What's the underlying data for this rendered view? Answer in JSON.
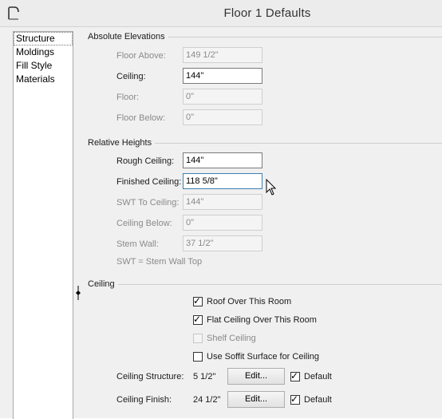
{
  "window": {
    "title": "Floor 1 Defaults"
  },
  "nav": {
    "items": [
      "Structure",
      "Moldings",
      "Fill Style",
      "Materials"
    ]
  },
  "absolute_elevations": {
    "title": "Absolute Elevations",
    "floor_above": {
      "label": "Floor Above:",
      "value": "149 1/2\""
    },
    "ceiling": {
      "label": "Ceiling:",
      "value": "144\""
    },
    "floor": {
      "label": "Floor:",
      "value": "0\""
    },
    "floor_below": {
      "label": "Floor Below:",
      "value": "0\""
    }
  },
  "relative_heights": {
    "title": "Relative Heights",
    "rough_ceiling": {
      "label": "Rough Ceiling:",
      "value": "144\""
    },
    "finished_ceiling": {
      "label": "Finished Ceiling:",
      "value": "118 5/8\""
    },
    "swt_to_ceiling": {
      "label": "SWT To Ceiling:",
      "value": "144\""
    },
    "ceiling_below": {
      "label": "Ceiling Below:",
      "value": "0\""
    },
    "stem_wall": {
      "label": "Stem Wall:",
      "value": "37 1/2\""
    },
    "note": "SWT = Stem Wall Top"
  },
  "ceiling": {
    "title": "Ceiling",
    "roof_over": {
      "label": "Roof Over This Room",
      "checked": true
    },
    "flat_ceiling": {
      "label": "Flat Ceiling Over This Room",
      "checked": true
    },
    "shelf_ceiling": {
      "label": "Shelf Ceiling",
      "checked": false
    },
    "soffit": {
      "label": "Use Soffit Surface for Ceiling",
      "checked": false
    },
    "structure": {
      "label": "Ceiling Structure:",
      "value": "5 1/2\"",
      "button": "Edit...",
      "default_label": "Default",
      "default_checked": true
    },
    "finish": {
      "label": "Ceiling Finish:",
      "value": "24 1/2\"",
      "button": "Edit...",
      "default_label": "Default",
      "default_checked": true
    }
  },
  "checkmark": "✓"
}
